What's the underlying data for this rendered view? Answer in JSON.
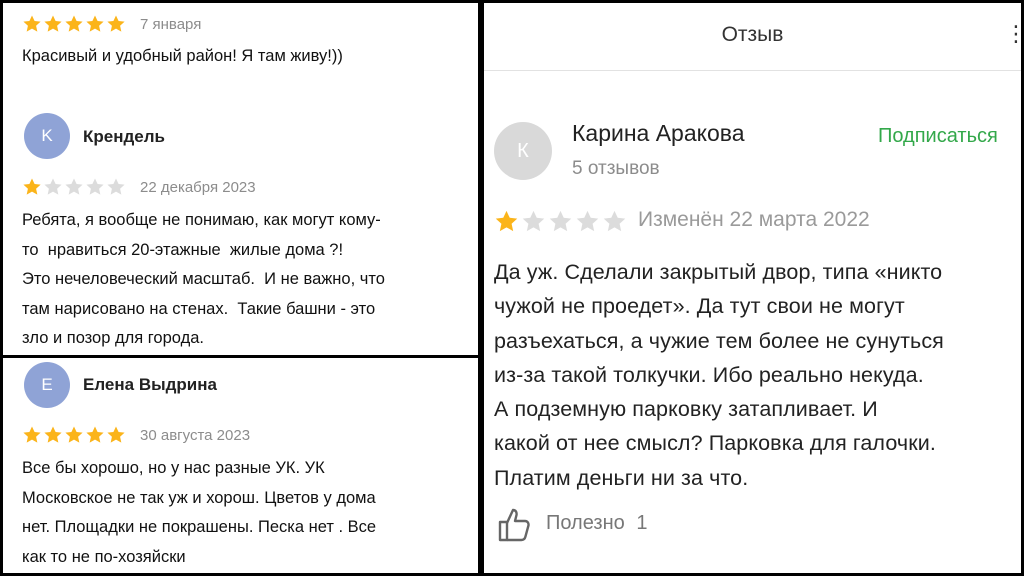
{
  "review_top": {
    "date": "7 января",
    "rating": 5,
    "text": "Красивый и удобный район! Я там живу!))"
  },
  "review_krendel": {
    "avatar_letter": "K",
    "avatar_color": "#8fa3d6",
    "name": "Крендель",
    "rating": 1,
    "date": "22 декабря 2023",
    "text": "Ребята, я вообще не понимаю, как могут кому-\nто  нравиться 20-этажные  жилые дома ?!\nЭто нечеловеческий масштаб.  И не важно, что\nтам нарисовано на стенах.  Такие башни - это\nзло и позор для города."
  },
  "review_elena": {
    "avatar_letter": "Е",
    "avatar_color": "#8fa3d6",
    "name": "Елена Выдрина",
    "rating": 5,
    "date": "30 августа 2023",
    "text": "Все бы хорошо, но у нас разные УК. УК\nМосковское не так уж и хорош. Цветов у дома\nнет. Площадки не покрашены. Песка нет . Все\nкак то не по-хозяйски"
  },
  "review_detail": {
    "header_title": "Отзыв",
    "back_icon": "chevron-left-icon",
    "more_icon": "more-dots-icon",
    "avatar_letter": "К",
    "name": "Карина Аракова",
    "review_count": "5 отзывов",
    "subscribe_label": "Подписаться",
    "subscribe_color": "#33a84a",
    "rating": 1,
    "date": "Изменён 22 марта 2022",
    "text": "Да уж. Сделали закрытый двор, типа «никто\nчужой не проедет». Да тут свои не могут\nразъехаться, а чужие тем более не сунуться\nиз-за такой толкучки. Ибо реально некуда.\nА подземную парковку затапливает. И\nкакой от нее смысл? Парковка для галочки.\nПлатим деньги ни за что.",
    "useful_label": "Полезно",
    "useful_count": "1"
  },
  "colors": {
    "star_on": "#fbb41a",
    "star_off": "#dcdcdc"
  }
}
